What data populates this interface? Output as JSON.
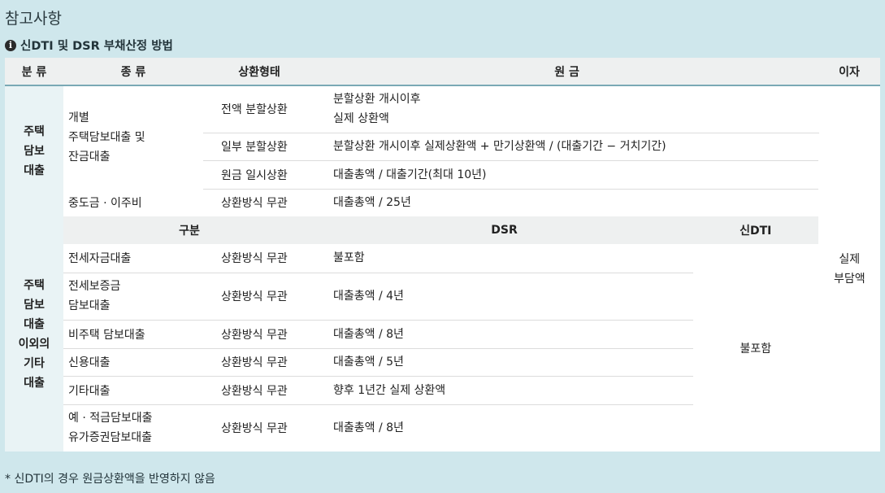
{
  "page_title": "참고사항",
  "subtitle": "신DTI 및 DSR 부채산정 방법",
  "icon": "info-icon",
  "headers": {
    "category": "분 류",
    "type": "종 류",
    "repay": "상환형태",
    "principal": "원 금",
    "interest": "이자"
  },
  "section1": {
    "category": [
      "주택",
      "담보",
      "대출"
    ],
    "individual_type": [
      "개별",
      "주택담보대출 및",
      "잔금대출"
    ],
    "rows": [
      {
        "repay": "전액 분할상환",
        "principal": [
          "분할상환 개시이후",
          "실제 상환액"
        ]
      },
      {
        "repay": "일부 분할상환",
        "principal": [
          "분할상환 개시이후 실제상환액 + 만기상환액 / (대출기간 − 거치기간)"
        ]
      },
      {
        "repay": "원금 일시상환",
        "principal": [
          "대출총액 / 대출기간(최대 10년)"
        ]
      }
    ],
    "mid_row": {
      "type": "중도금 · 이주비",
      "repay": "상환방식 무관",
      "principal": "대출총액 / 25년"
    }
  },
  "interest": [
    "실제",
    "부담액"
  ],
  "section2": {
    "category": [
      "주택",
      "담보",
      "대출",
      "이외의",
      "기타",
      "대출"
    ],
    "sub_headers": {
      "group": "구분",
      "dsr": "DSR",
      "new_dti": "신DTI"
    },
    "rows": [
      {
        "type": [
          "전세자금대출"
        ],
        "repay": "상환방식 무관",
        "dsr": "불포함"
      },
      {
        "type": [
          "전세보증금",
          "담보대출"
        ],
        "repay": "상환방식 무관",
        "dsr": "대출총액 / 4년"
      },
      {
        "type": [
          "비주택 담보대출"
        ],
        "repay": "상환방식 무관",
        "dsr": "대출총액 / 8년"
      },
      {
        "type": [
          "신용대출"
        ],
        "repay": "상환방식 무관",
        "dsr": "대출총액 / 5년"
      },
      {
        "type": [
          "기타대출"
        ],
        "repay": "상환방식 무관",
        "dsr": "향후 1년간 실제 상환액"
      },
      {
        "type": [
          "예 · 적금담보대출",
          "유가증권담보대출"
        ],
        "repay": "상환방식 무관",
        "dsr": "대출총액 / 8년"
      }
    ],
    "new_dti_value": "불포함"
  },
  "footnote": "* 신DTI의 경우 원금상환액을 반영하지 않음"
}
